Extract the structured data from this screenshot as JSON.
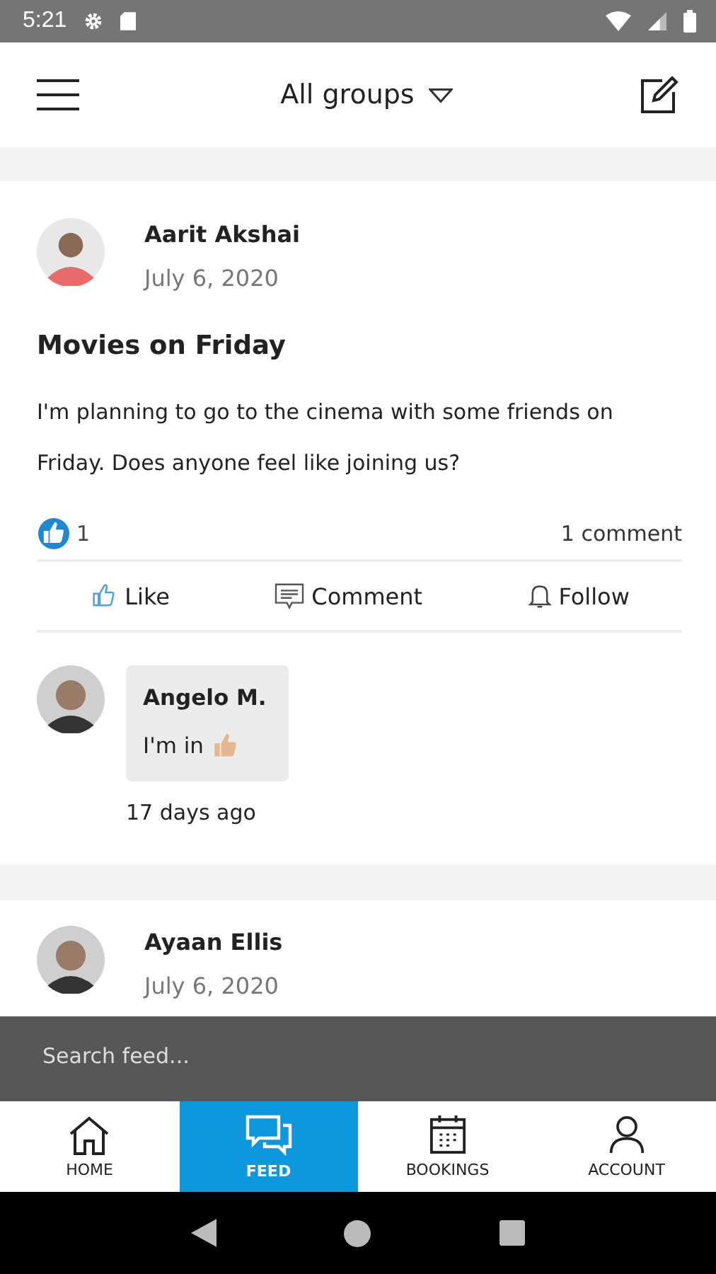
{
  "status_bar": {
    "time": "5:21"
  },
  "header": {
    "title": "All groups"
  },
  "posts": [
    {
      "author": "Aarit Akshai",
      "date": "July 6, 2020",
      "title": "Movies on Friday",
      "body": "I'm planning to go to the cinema with some friends on Friday. Does anyone feel like joining us?",
      "like_count": "1",
      "comment_count": "1 comment",
      "liked": true,
      "actions": [
        {
          "kind": "like",
          "label": "Like"
        },
        {
          "kind": "comment",
          "label": "Comment"
        },
        {
          "kind": "follow",
          "label": "Follow"
        }
      ],
      "comments": [
        {
          "author": "Angelo M.",
          "text": "I'm in",
          "time": "17 days ago"
        }
      ]
    },
    {
      "author": "Ayaan Ellis",
      "date": "July 6, 2020"
    }
  ],
  "search": {
    "placeholder": "Search feed..."
  },
  "tabs": [
    {
      "kind": "home",
      "label": "HOME",
      "selected": false
    },
    {
      "kind": "feed",
      "label": "FEED",
      "selected": true
    },
    {
      "kind": "bookings",
      "label": "BOOKINGS",
      "selected": false
    },
    {
      "kind": "account",
      "label": "ACCOUNT",
      "selected": false
    }
  ]
}
